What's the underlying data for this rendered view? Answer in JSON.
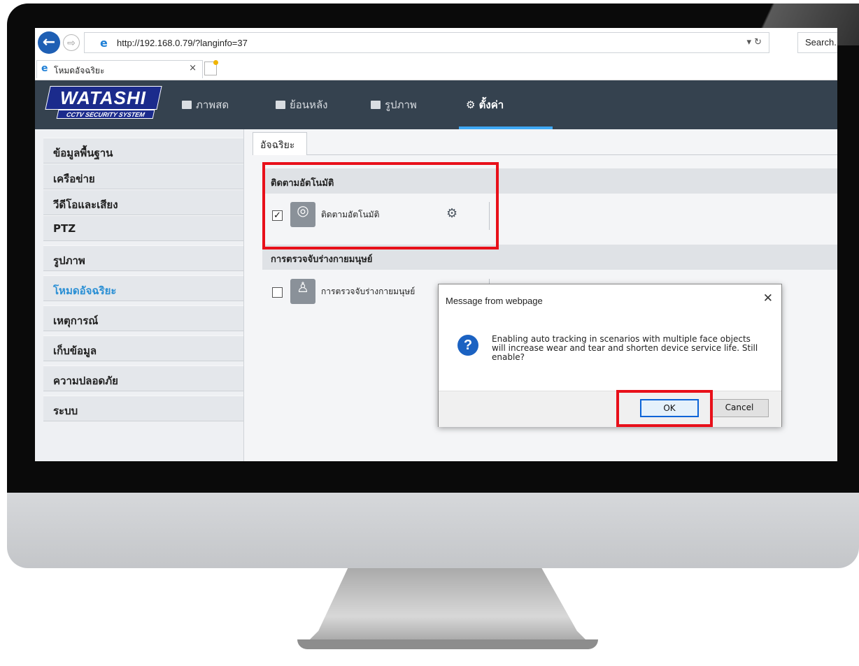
{
  "browser": {
    "url": "http://192.168.0.79/?langinfo=37",
    "search_label": "Search...",
    "tab_title": "โหมดอัจฉริยะ",
    "tab_close": "×"
  },
  "header": {
    "logo_text": "WATASHI",
    "logo_sub": "CCTV SECURITY SYSTEM",
    "menu": [
      {
        "label": "ภาพสด"
      },
      {
        "label": "ย้อนหลัง"
      },
      {
        "label": "รูปภาพ"
      },
      {
        "label": "ตั้งค่า"
      }
    ]
  },
  "sidebar": {
    "items": [
      {
        "label": "ข้อมูลพื้นฐาน"
      },
      {
        "label": "เครือข่าย"
      },
      {
        "label": "วีดีโอและเสียง"
      },
      {
        "label": "PTZ"
      },
      {
        "label": "รูปภาพ"
      },
      {
        "label": "โหมดอัจฉริยะ"
      },
      {
        "label": "เหตุการณ์"
      },
      {
        "label": "เก็บข้อมูล"
      },
      {
        "label": "ความปลอดภัย"
      },
      {
        "label": "ระบบ"
      }
    ]
  },
  "main": {
    "tab_label": "อัจฉริยะ",
    "sections": [
      {
        "title": "ติดตามอัตโนมัติ",
        "feature_label": "ติดตามอัตโนมัติ",
        "checked": true
      },
      {
        "title": "การตรวจจับร่างกายมนุษย์",
        "feature_label": "การตรวจจับร่างกายมนุษย์",
        "checked": false
      }
    ]
  },
  "dialog": {
    "title": "Message from webpage",
    "close": "✕",
    "message": "Enabling auto tracking in scenarios with multiple face objects will increase wear and tear and shorten device service life. Still enable?",
    "ok_label": "OK",
    "cancel_label": "Cancel",
    "icon_glyph": "?"
  },
  "colors": {
    "header_bg": "#35424f",
    "active_blue": "#2a8fd4",
    "highlight_red": "#e8101a"
  }
}
